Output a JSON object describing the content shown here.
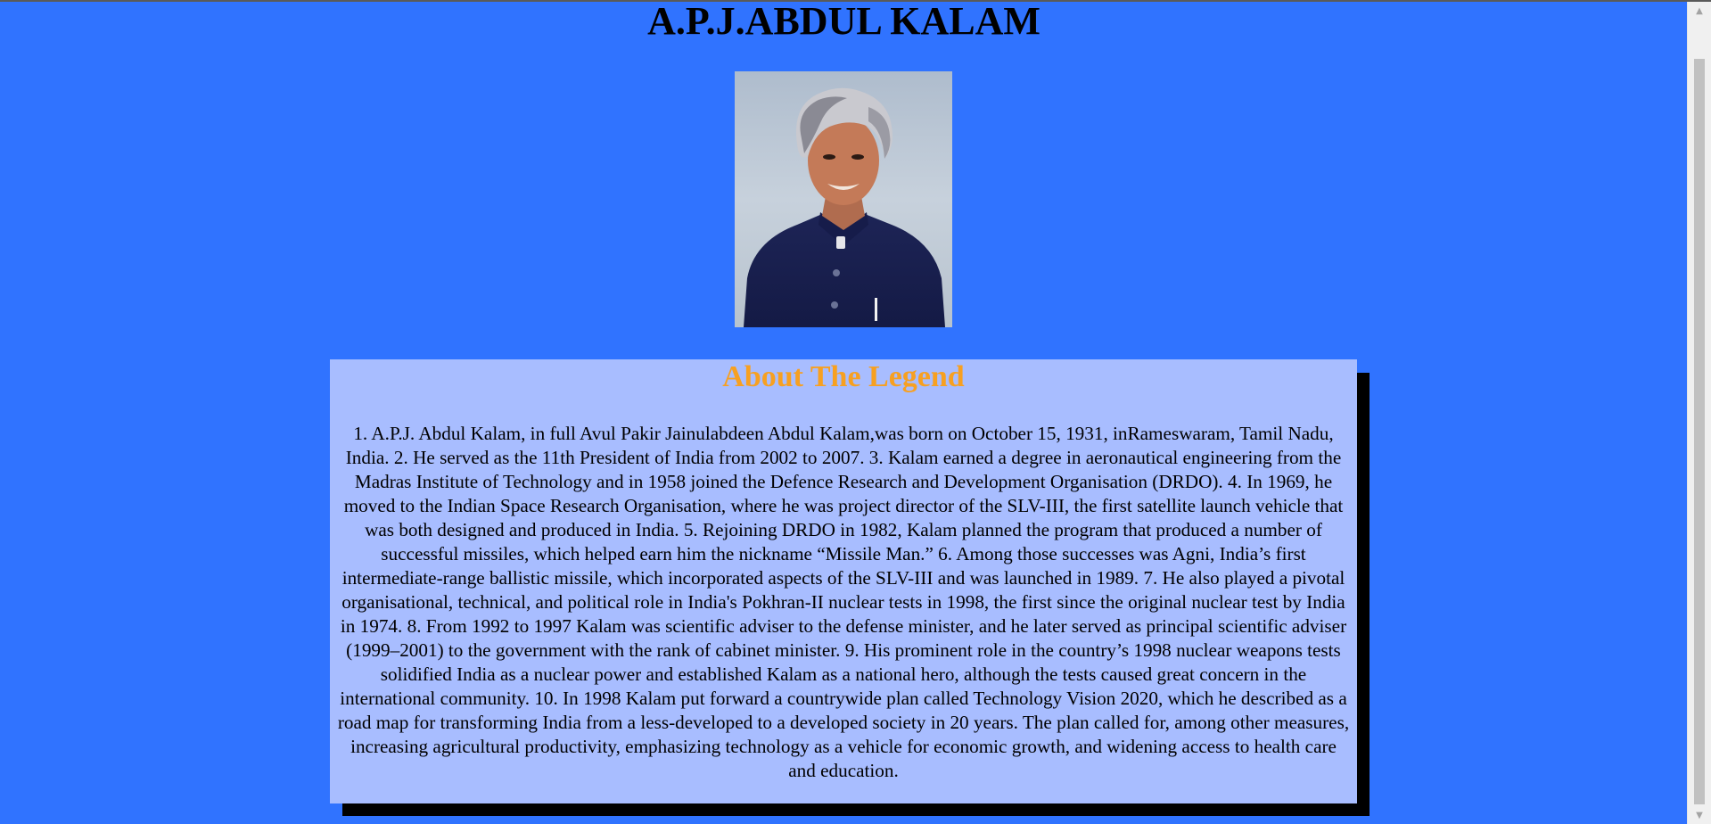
{
  "page": {
    "title": "A.P.J.ABDUL KALAM",
    "portrait_alt": "A.P.J. Abdul Kalam portrait"
  },
  "about": {
    "heading": "About The Legend",
    "text": "1. A.P.J. Abdul Kalam, in full Avul Pakir Jainulabdeen Abdul Kalam,was born on October 15, 1931, inRameswaram, Tamil Nadu, India. 2. He served as the 11th President of India from 2002 to 2007. 3. Kalam earned a degree in aeronautical engineering from the Madras Institute of Technology and in 1958 joined the Defence Research and Development Organisation (DRDO). 4. In 1969, he moved to the Indian Space Research Organisation, where he was project director of the SLV-III, the first satellite launch vehicle that was both designed and produced in India. 5. Rejoining DRDO in 1982, Kalam planned the program that produced a number of successful missiles, which helped earn him the nickname “Missile Man.” 6. Among those successes was Agni, India’s first intermediate-range ballistic missile, which incorporated aspects of the SLV-III and was launched in 1989. 7. He also played a pivotal organisational, technical, and political role in India's Pokhran-II nuclear tests in 1998, the first since the original nuclear test by India in 1974. 8. From 1992 to 1997 Kalam was scientific adviser to the defense minister, and he later served as principal scientific adviser (1999–2001) to the government with the rank of cabinet minister. 9. His prominent role in the country’s 1998 nuclear weapons tests solidified India as a nuclear power and established Kalam as a national hero, although the tests caused great concern in the international community. 10. In 1998 Kalam put forward a countrywide plan called Technology Vision 2020, which he described as a road map for transforming India from a less-developed to a developed society in 20 years. The plan called for, among other measures, increasing agricultural productivity, emphasizing technology as a vehicle for economic growth, and widening access to health care and education."
  },
  "colors": {
    "background": "#3073ff",
    "about_box": "#a8bdff",
    "heading": "#f7a021",
    "shadow": "#000000"
  },
  "scrollbar": {
    "up_icon": "chevron-up-icon",
    "down_icon": "chevron-down-icon"
  }
}
